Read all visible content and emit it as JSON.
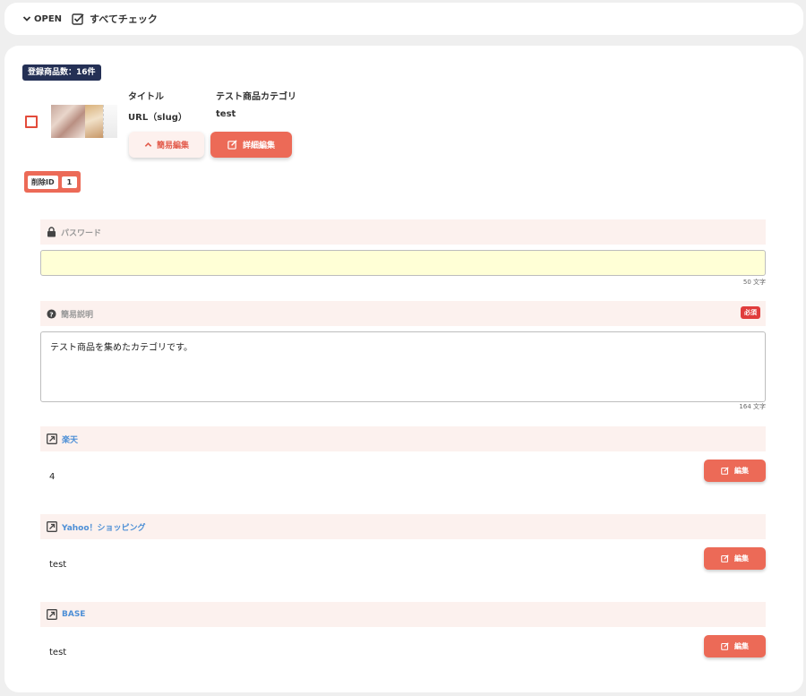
{
  "topbar": {
    "open_label": "OPEN",
    "check_all_label": "すべてチェック"
  },
  "registered": {
    "label": "登録商品数：16件"
  },
  "item": {
    "title_label": "タイトル",
    "title_value": "テスト商品カテゴリ",
    "slug_label": "URL（slug）",
    "slug_value": "test",
    "simple_edit_label": "簡易編集",
    "detail_edit_label": "詳細編集"
  },
  "delete_id": {
    "label": "削除ID",
    "value": "1"
  },
  "password": {
    "label": "パスワード",
    "value": "",
    "count": "50 文字"
  },
  "description": {
    "label": "簡易説明",
    "required": "必須",
    "value": "テスト商品を集めたカテゴリです。",
    "count": "164 文字"
  },
  "shops": [
    {
      "name": "楽天",
      "value": "4",
      "edit_label": "編集"
    },
    {
      "name": "Yahoo！ショッピング",
      "value": "test",
      "edit_label": "編集"
    },
    {
      "name": "BASE",
      "value": "test",
      "edit_label": "編集"
    }
  ],
  "colors": {
    "accent": "#ec6a57",
    "badge": "#243055",
    "field_head": "#fcf1ee",
    "input_bg": "#ffffd6",
    "link": "#4d8fd6"
  }
}
